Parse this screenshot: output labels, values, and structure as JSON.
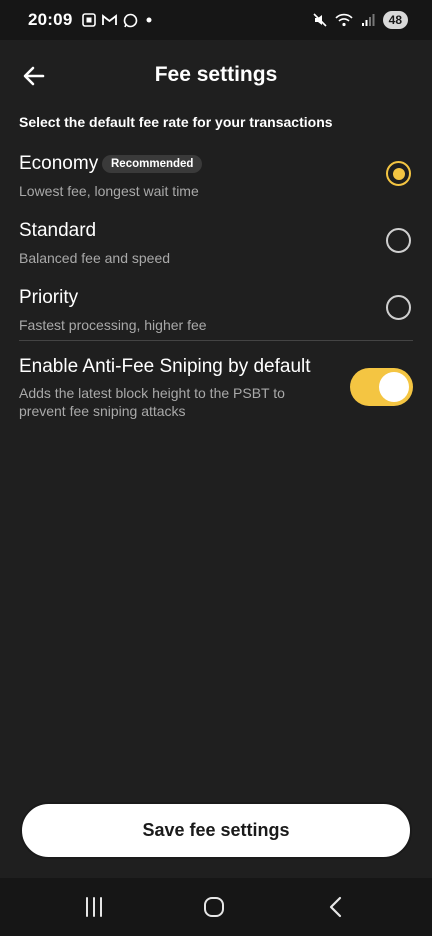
{
  "status_bar": {
    "time": "20:09",
    "battery": "48",
    "left_icons": [
      "screenshot-icon",
      "gmail-icon",
      "whatsapp-icon",
      "dot-icon"
    ],
    "right_icons": [
      "mute-icon",
      "wifi-icon",
      "signal-icon"
    ]
  },
  "header": {
    "title": "Fee settings",
    "back_icon": "arrow-left-icon"
  },
  "main": {
    "subtitle": "Select the default fee rate for your transactions",
    "options": [
      {
        "title": "Economy",
        "badge": "Recommended",
        "description": "Lowest fee, longest wait time",
        "selected": true
      },
      {
        "title": "Standard",
        "description": "Balanced fee and speed",
        "selected": false
      },
      {
        "title": "Priority",
        "description": "Fastest processing, higher fee",
        "selected": false
      }
    ],
    "anti_fee_sniping": {
      "title": "Enable Anti-Fee Sniping by default",
      "description": "Adds the latest block height to the PSBT to prevent fee sniping attacks",
      "enabled": true
    }
  },
  "footer": {
    "save_label": "Save fee settings"
  },
  "nav_bar": {
    "icons": [
      "recent-apps-icon",
      "home-icon",
      "back-icon"
    ]
  },
  "colors": {
    "accent": "#f4c542",
    "background": "#1f1f1f",
    "secondary_text": "#a9a9a9"
  }
}
